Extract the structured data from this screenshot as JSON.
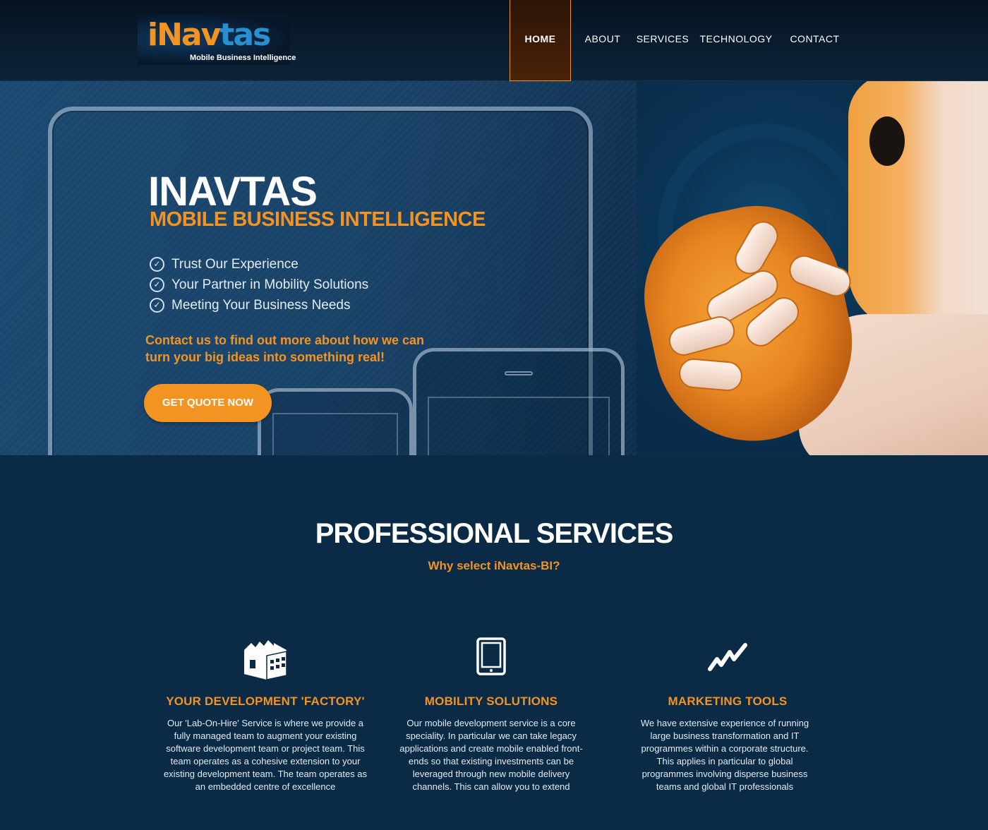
{
  "logo": {
    "word_orange": "iN",
    "word_blue_a": "av",
    "word_blue_b": "tas",
    "tagline": "Mobile Business Intelligence"
  },
  "nav": [
    {
      "label": "HOME",
      "active": true
    },
    {
      "label": "ABOUT",
      "active": false
    },
    {
      "label": "SERVICES",
      "active": false
    },
    {
      "label": "TECHNOLOGY",
      "active": false
    },
    {
      "label": "CONTACT",
      "active": false
    }
  ],
  "hero": {
    "title": "INAVTAS",
    "subtitle": "MOBILE BUSINESS INTELLIGENCE",
    "checks": [
      "Trust Our Experience",
      "Your Partner in Mobility Solutions",
      "Meeting Your Business Needs"
    ],
    "cta_text": "Contact us to find out more about how we can turn your big ideas into something real!",
    "cta_button": "GET QUOTE NOW"
  },
  "services": {
    "title": "PROFESSIONAL SERVICES",
    "subtitle": "Why select iNavtas-BI?",
    "items": [
      {
        "icon": "factory-icon",
        "title": "YOUR DEVELOPMENT 'FACTORY'",
        "text": "Our 'Lab-On-Hire' Service is where we provide a fully managed team to augment your existing software development team or project team. This team operates as a cohesive extension to your existing development team. The team operates as an embedded centre of excellence"
      },
      {
        "icon": "tablet-icon",
        "title": "MOBILITY SOLUTIONS",
        "text": "Our mobile development service is a core speciality. In particular we can take legacy applications and create mobile enabled front-ends so that existing investments can be leveraged through new mobile delivery channels. This can allow you to extend"
      },
      {
        "icon": "trend-chart-icon",
        "title": "MARKETING TOOLS",
        "text": "We have extensive experience of running large business transformation and IT programmes within a corporate structure. This applies in particular to global programmes involving disperse business teams and global IT professionals"
      }
    ]
  },
  "colors": {
    "accent": "#f39322",
    "background": "#0b2a45",
    "header": "#06121e"
  }
}
